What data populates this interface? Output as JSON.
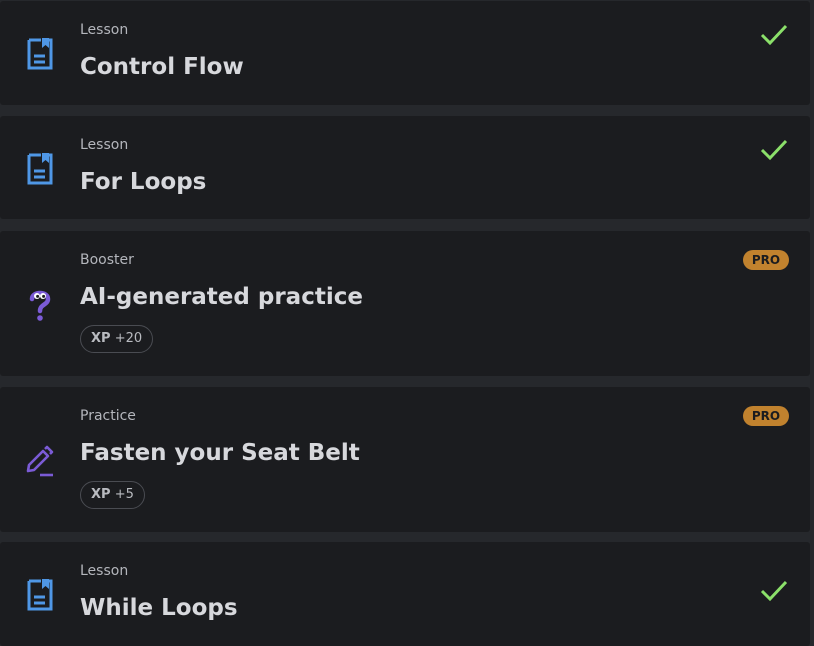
{
  "colors": {
    "background": "#26282c",
    "card": "#1b1c1f",
    "lesson_icon": "#4f97e6",
    "purple_icon": "#7b5bd6",
    "check": "#8be06a",
    "pro_badge": "#c1822e"
  },
  "items": [
    {
      "kind": "Lesson",
      "title": "Control Flow",
      "icon": "lesson-doc-icon",
      "status": "completed"
    },
    {
      "kind": "Lesson",
      "title": "For Loops",
      "icon": "lesson-doc-icon",
      "status": "completed"
    },
    {
      "kind": "Booster",
      "title": "AI-generated practice",
      "icon": "question-mark-icon",
      "badge": "PRO",
      "xp_label": "XP",
      "xp_value": "+20"
    },
    {
      "kind": "Practice",
      "title": "Fasten your Seat Belt",
      "icon": "pencil-icon",
      "badge": "PRO",
      "xp_label": "XP",
      "xp_value": "+5"
    },
    {
      "kind": "Lesson",
      "title": "While Loops",
      "icon": "lesson-doc-icon",
      "status": "completed"
    }
  ]
}
